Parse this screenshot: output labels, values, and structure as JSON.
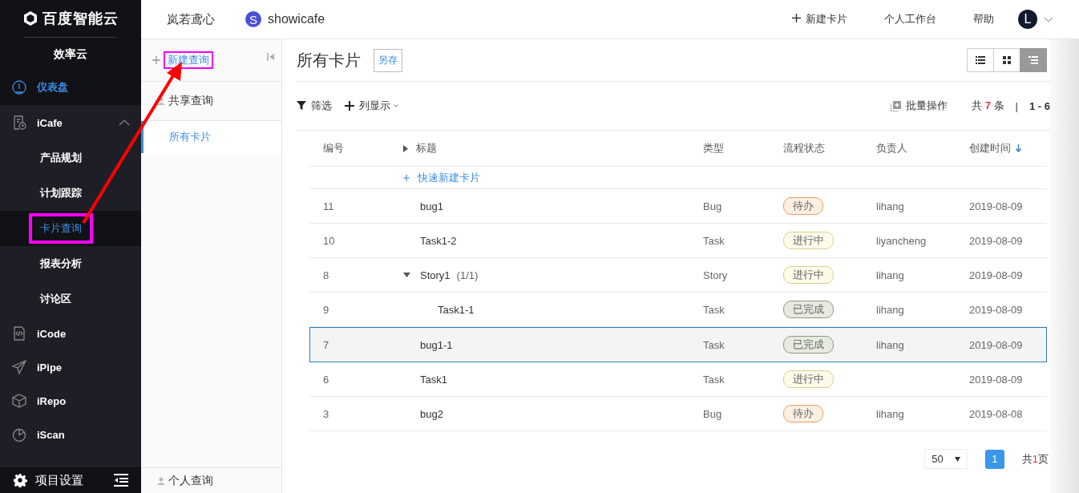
{
  "sidebar": {
    "logo": "百度智能云",
    "product": "效率云",
    "items": [
      {
        "label": "仪表盘",
        "selected": true
      },
      {
        "label": "iCafe",
        "selected": false,
        "expanded": true,
        "children": [
          {
            "label": "产品规划",
            "selected": false,
            "annotated": false
          },
          {
            "label": "计划跟踪",
            "selected": false,
            "annotated": false
          },
          {
            "label": "卡片查询",
            "selected": true,
            "annotated": true
          },
          {
            "label": "报表分析",
            "selected": false,
            "annotated": false
          },
          {
            "label": "讨论区",
            "selected": false,
            "annotated": false
          }
        ]
      },
      {
        "label": "iCode",
        "selected": false
      },
      {
        "label": "iPipe",
        "selected": false
      },
      {
        "label": "iRepo",
        "selected": false
      },
      {
        "label": "iScan",
        "selected": false
      }
    ],
    "settings": "项目设置"
  },
  "header": {
    "space": "岚若鸢心",
    "project_avatar": "S",
    "project": "showicafe",
    "new_card": "新建卡片",
    "workbench": "个人工作台",
    "help": "帮助",
    "user_avatar": "L"
  },
  "query_panel": {
    "new_query": "新建查询",
    "new_query_annotated": true,
    "shared_title": "共享查询",
    "shared_items": [
      {
        "label": "所有卡片",
        "selected": true
      }
    ],
    "personal_title": "个人查询"
  },
  "main": {
    "title": "所有卡片",
    "save_as": "另存",
    "view_buttons": [
      {
        "kind": "list",
        "selected": false
      },
      {
        "kind": "grid",
        "selected": false
      },
      {
        "kind": "tree",
        "selected": true
      }
    ],
    "filter": "筛选",
    "columns_toggle": "列显示",
    "batch": "批量操作",
    "count_prefix": "共",
    "count": "7",
    "count_suffix": "条",
    "separator": "|",
    "range": "1 - 6"
  },
  "table": {
    "columns": [
      "编号",
      "标题",
      "类型",
      "流程状态",
      "负责人",
      "创建时间"
    ],
    "quick_create": "快速新建卡片",
    "rows": [
      {
        "id": "11",
        "title": "bug1",
        "type": "Bug",
        "status": {
          "label": "待办",
          "kind": "todo"
        },
        "owner": "lihang",
        "date": "2019-08-09",
        "selected": false
      },
      {
        "id": "10",
        "title": "Task1-2",
        "type": "Task",
        "status": {
          "label": "进行中",
          "kind": "doing"
        },
        "owner": "liyancheng",
        "date": "2019-08-09",
        "selected": false
      },
      {
        "id": "8",
        "title": "Story1",
        "progress": "(1/1)",
        "expanded": true,
        "type": "Story",
        "status": {
          "label": "进行中",
          "kind": "doing"
        },
        "owner": "lihang",
        "date": "2019-08-09",
        "selected": false,
        "children": [
          {
            "id": "9",
            "title": "Task1-1",
            "type": "Task",
            "status": {
              "label": "已完成",
              "kind": "done"
            },
            "owner": "lihang",
            "date": "2019-08-09",
            "selected": false
          }
        ]
      },
      {
        "id": "7",
        "title": "bug1-1",
        "type": "Task",
        "status": {
          "label": "已完成",
          "kind": "done"
        },
        "owner": "lihang",
        "date": "2019-08-09",
        "selected": true
      },
      {
        "id": "6",
        "title": "Task1",
        "type": "Task",
        "status": {
          "label": "进行中",
          "kind": "doing"
        },
        "date": "2019-08-09",
        "selected": false
      },
      {
        "id": "3",
        "title": "bug2",
        "type": "Bug",
        "status": {
          "label": "待办",
          "kind": "todo"
        },
        "owner": "lihang",
        "date": "2019-08-08",
        "selected": false
      }
    ]
  },
  "pagination": {
    "page_size": "50",
    "pages": [
      {
        "label": "1",
        "selected": true
      }
    ],
    "total_prefix": "共",
    "total": "1",
    "total_suffix": "页"
  }
}
